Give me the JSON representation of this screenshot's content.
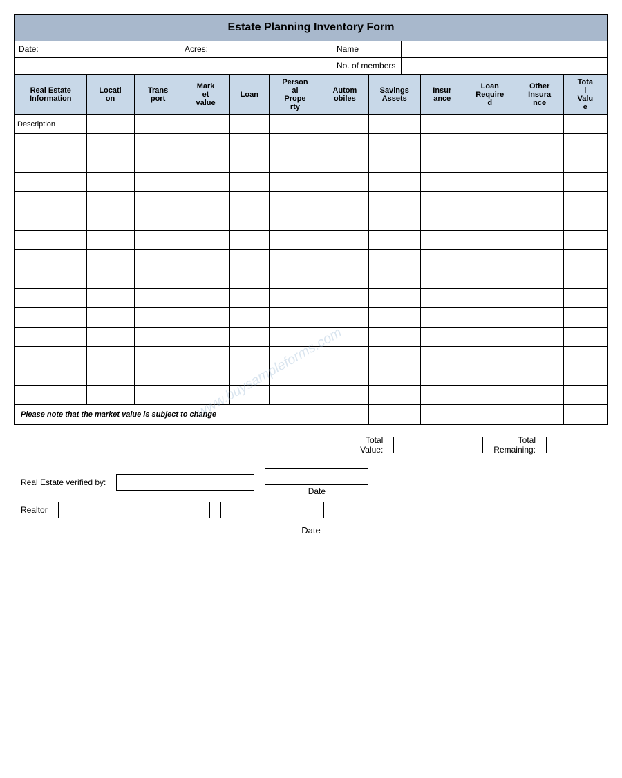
{
  "title": "Estate Planning Inventory Form",
  "header": {
    "date_label": "Date:",
    "acres_label": "Acres:",
    "name_label": "Name",
    "no_members_label": "No. of members"
  },
  "columns": [
    {
      "key": "real_estate",
      "label": "Real Estate Information"
    },
    {
      "key": "location",
      "label": "Location"
    },
    {
      "key": "transport",
      "label": "Transport"
    },
    {
      "key": "market_value",
      "label": "Market value"
    },
    {
      "key": "loan",
      "label": "Loan"
    },
    {
      "key": "personal_property",
      "label": "Personal Property"
    },
    {
      "key": "automobiles",
      "label": "Automobiles"
    },
    {
      "key": "savings_assets",
      "label": "Savings Assets"
    },
    {
      "key": "insurance",
      "label": "Insurance"
    },
    {
      "key": "loan_required",
      "label": "Loan Required"
    },
    {
      "key": "other_insurance",
      "label": "Other Insurance"
    },
    {
      "key": "total_value",
      "label": "Total Value"
    }
  ],
  "description_label": "Description",
  "data_rows": 14,
  "notice": "Please note that the market value is subject to change",
  "total_value_label": "Total\nValue:",
  "total_remaining_label": "Total\nRemaining:",
  "real_estate_verified_label": "Real Estate verified by:",
  "date_label_verified": "Date",
  "realtor_label": "Realtor",
  "date_label_bottom": "Date",
  "watermark": "www.buysampleforms.com"
}
